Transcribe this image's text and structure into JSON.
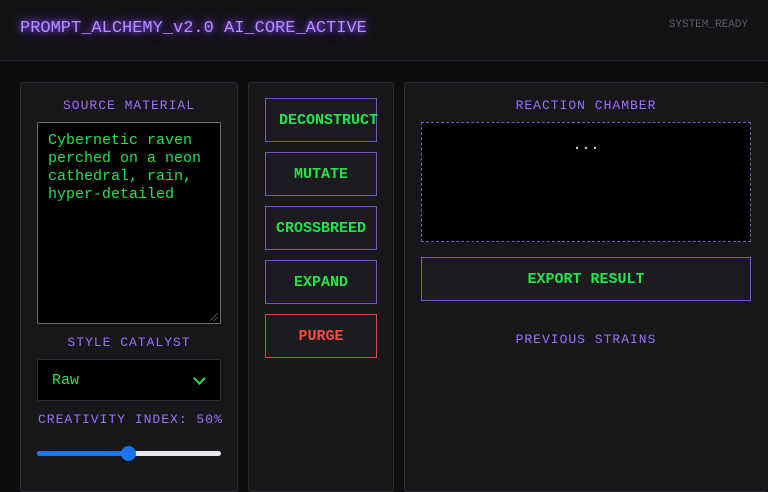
{
  "header": {
    "title": "PROMPT_ALCHEMY_v2.0 AI_CORE_ACTIVE",
    "status": "SYSTEM_READY"
  },
  "source": {
    "label": "SOURCE MATERIAL",
    "text": "Cybernetic raven perched on a neon cathedral, rain, hyper-detailed"
  },
  "style": {
    "label": "STYLE CATALYST",
    "selected": "Raw"
  },
  "creativity": {
    "label": "CREATIVITY INDEX: 50%",
    "value": 0.5
  },
  "actions": {
    "deconstruct": "DECONSTRUCT",
    "mutate": "MUTATE",
    "crossbreed": "CROSSBREED",
    "expand": "EXPAND",
    "purge": "PURGE"
  },
  "reaction": {
    "label": "REACTION CHAMBER",
    "output": "...",
    "export_label": "EXPORT RESULT",
    "previous_label": "PREVIOUS STRAINS"
  },
  "colors": {
    "accent": "#9b6fff",
    "text_green": "#22e34a",
    "danger": "#ff4a3e",
    "slider": "#1a73e8"
  }
}
